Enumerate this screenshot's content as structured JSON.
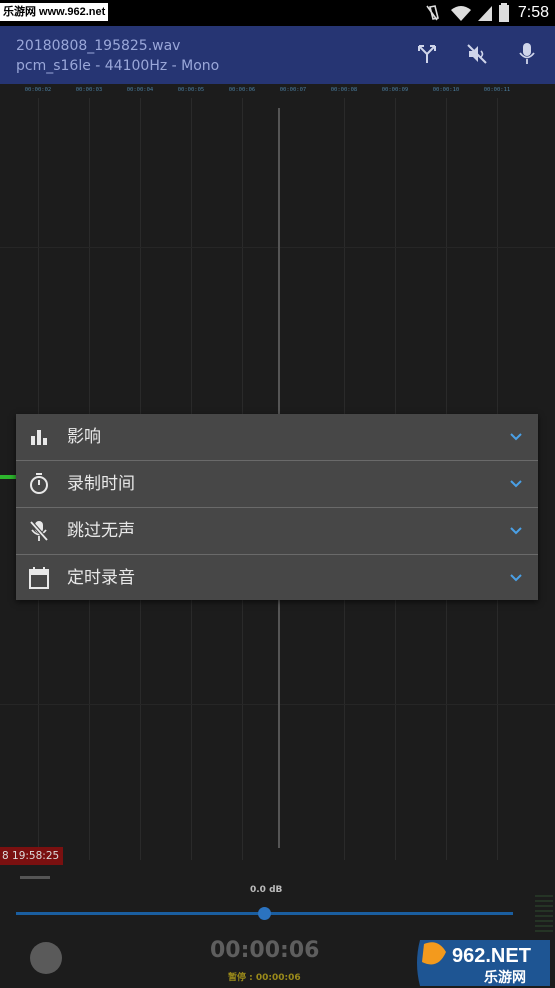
{
  "status_bar": {
    "watermark": "乐游网 www.962.net",
    "time": "7:58"
  },
  "app_bar": {
    "file_name": "20180808_195825.wav",
    "file_format": "pcm_s16le - 44100Hz - Mono"
  },
  "waveform": {
    "ruler_ticks": [
      "00:00:02",
      "00:00:03",
      "00:00:04",
      "00:00:05",
      "00:00:06",
      "00:00:07",
      "00:00:08",
      "00:00:09",
      "00:00:10",
      "00:00:11"
    ],
    "record_timestamp": "8 19:58:25"
  },
  "menu": {
    "items": [
      {
        "label": "影响",
        "icon": "bar-chart-icon"
      },
      {
        "label": "录制时间",
        "icon": "timer-icon"
      },
      {
        "label": "跳过无声",
        "icon": "mic-off-icon"
      },
      {
        "label": "定时录音",
        "icon": "calendar-icon"
      }
    ]
  },
  "controls": {
    "gain_label": "0.0 dB",
    "gain_value": 0.5,
    "elapsed_time": "00:00:06",
    "pause_time": "暂停 : 00:00:06"
  },
  "logo": {
    "brand": "962.NET",
    "tagline": "乐游网"
  },
  "colors": {
    "app_bar": "#263573",
    "menu_bg": "#474747",
    "accent": "#2b73c0",
    "timestamp_bg": "#7a1010",
    "marker": "#2db52d"
  }
}
